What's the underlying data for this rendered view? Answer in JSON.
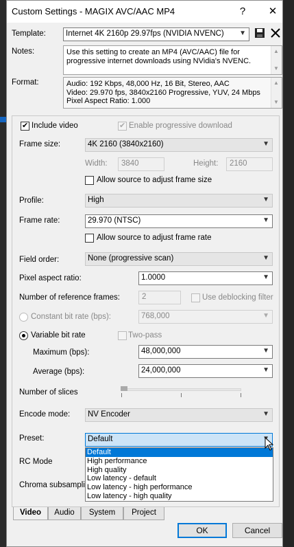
{
  "window": {
    "title": "Custom Settings - MAGIX AVC/AAC MP4"
  },
  "titlebar": {
    "help_label": "?",
    "close_label": "✕"
  },
  "template": {
    "label": "Template:",
    "value": "Internet 4K 2160p 29.97fps (NVIDIA NVENC)"
  },
  "notes": {
    "label": "Notes:",
    "line1": "Use this setting to create an MP4 (AVC/AAC) file for",
    "line2": "progressive internet downloads using NVidia's NVENC."
  },
  "format": {
    "label": "Format:",
    "line1": "Audio: 192 Kbps, 48,000 Hz, 16 Bit, Stereo, AAC",
    "line2": "Video: 29.970 fps, 3840x2160 Progressive, YUV, 24 Mbps",
    "line3": "Pixel Aspect Ratio: 1.000"
  },
  "video": {
    "include_video": {
      "label": "Include video",
      "checked": true
    },
    "progressive_download": {
      "label": "Enable progressive download",
      "checked": true
    },
    "frame_size": {
      "label": "Frame size:",
      "value": "4K 2160 (3840x2160)"
    },
    "width": {
      "label": "Width:",
      "value": "3840"
    },
    "height": {
      "label": "Height:",
      "value": "2160"
    },
    "allow_frame_size": {
      "label": "Allow source to adjust frame size"
    },
    "profile": {
      "label": "Profile:",
      "value": "High"
    },
    "frame_rate": {
      "label": "Frame rate:",
      "value": "29.970 (NTSC)"
    },
    "allow_frame_rate": {
      "label": "Allow source to adjust frame rate"
    },
    "field_order": {
      "label": "Field order:",
      "value": "None (progressive scan)"
    },
    "pixel_aspect": {
      "label": "Pixel aspect ratio:",
      "value": "1.0000"
    },
    "ref_frames": {
      "label": "Number of reference frames:",
      "value": "2"
    },
    "deblocking": {
      "label": "Use deblocking filter"
    },
    "constant_bitrate": {
      "label": "Constant bit rate (bps):",
      "value": "768,000"
    },
    "variable_bitrate": {
      "label": "Variable bit rate",
      "selected": true
    },
    "two_pass": {
      "label": "Two-pass"
    },
    "maximum": {
      "label": "Maximum (bps):",
      "value": "48,000,000"
    },
    "average": {
      "label": "Average (bps):",
      "value": "24,000,000"
    },
    "slices": {
      "label": "Number of slices"
    },
    "encode_mode": {
      "label": "Encode mode:",
      "value": "NV Encoder"
    },
    "preset": {
      "label": "Preset:",
      "value": "Default",
      "options": [
        "Default",
        "High performance",
        "High quality",
        "Low latency - default",
        "Low latency - high performance",
        "Low latency - high quality"
      ]
    },
    "rc_mode": {
      "label": "RC Mode"
    },
    "chroma": {
      "label": "Chroma subsampling"
    }
  },
  "tabs": [
    "Video",
    "Audio",
    "System",
    "Project"
  ],
  "buttons": {
    "ok": "OK",
    "cancel": "Cancel"
  },
  "colors": {
    "accent": "#0078d7",
    "selection": "#cce4f7"
  }
}
